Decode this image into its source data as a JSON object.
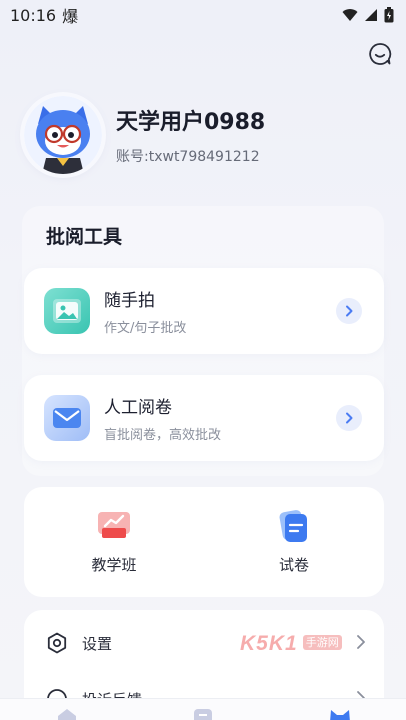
{
  "status_bar": {
    "time": "10:16",
    "indicator": "爆"
  },
  "profile": {
    "name": "天学用户0988",
    "account": "账号:txwt798491212"
  },
  "review_tools": {
    "title": "批阅工具",
    "items": [
      {
        "title": "随手拍",
        "subtitle": "作文/句子批改"
      },
      {
        "title": "人工阅卷",
        "subtitle": "盲批阅卷，高效批改"
      }
    ]
  },
  "quick_grid": [
    {
      "label": "教学班"
    },
    {
      "label": "试卷"
    }
  ],
  "settings": [
    {
      "label": "设置"
    },
    {
      "label": "投诉反馈"
    }
  ],
  "watermark": {
    "text": "K5K1",
    "sub": "手游网"
  },
  "colors": {
    "accent": "#4b7cf3",
    "chevron_bg": "#e9eefc",
    "red": "#ef5b5b",
    "teal": "#45cdb8"
  }
}
